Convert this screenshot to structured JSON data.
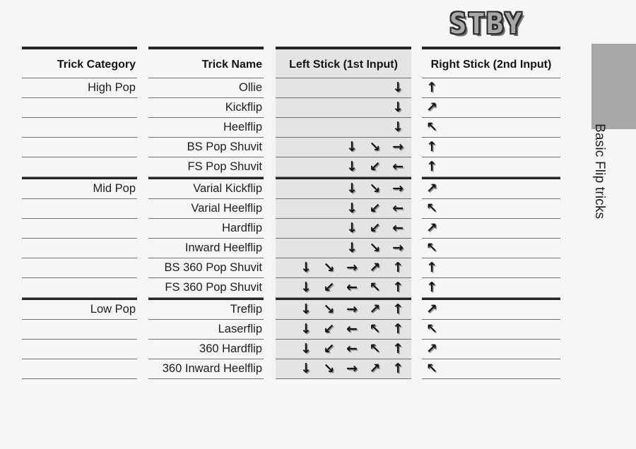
{
  "logo": {
    "text": "STBY"
  },
  "side_tab": {
    "label": "Basic Flip tricks",
    "block_color": "#a6a7a9"
  },
  "table": {
    "columns": [
      {
        "key": "category",
        "header": "Trick Category"
      },
      {
        "key": "name",
        "header": "Trick Name"
      },
      {
        "key": "left",
        "header": "Left Stick (1st Input)"
      },
      {
        "key": "right",
        "header": "Right Stick (2nd Input)"
      }
    ],
    "sections": [
      {
        "category": "High Pop",
        "rows": [
          {
            "name": "Ollie",
            "left": "↓",
            "right": "↑"
          },
          {
            "name": "Kickflip",
            "left": "↓",
            "right": "↗"
          },
          {
            "name": "Heelflip",
            "left": "↓",
            "right": "↖"
          },
          {
            "name": "BS Pop Shuvit",
            "left": "↓ ↘ →",
            "right": "↑"
          },
          {
            "name": "FS Pop Shuvit",
            "left": "↓ ↙ ←",
            "right": "↑"
          }
        ]
      },
      {
        "category": "Mid Pop",
        "rows": [
          {
            "name": "Varial Kickflip",
            "left": "↓ ↘ →",
            "right": "↗"
          },
          {
            "name": "Varial Heelflip",
            "left": "↓ ↙ ←",
            "right": "↖"
          },
          {
            "name": "Hardflip",
            "left": "↓ ↙ ←",
            "right": "↗"
          },
          {
            "name": "Inward Heelflip",
            "left": "↓ ↘ →",
            "right": "↖"
          },
          {
            "name": "BS 360 Pop Shuvit",
            "left": "↓ ↘ → ↗ ↑",
            "right": "↑"
          },
          {
            "name": "FS 360 Pop Shuvit",
            "left": "↓ ↙ ← ↖ ↑",
            "right": "↑"
          }
        ]
      },
      {
        "category": "Low Pop",
        "rows": [
          {
            "name": "Treflip",
            "left": "↓ ↘ → ↗ ↑",
            "right": "↗"
          },
          {
            "name": "Laserflip",
            "left": "↓ ↙ ← ↖ ↑",
            "right": "↖"
          },
          {
            "name": "360 Hardflip",
            "left": "↓ ↙ ← ↖ ↑",
            "right": "↗"
          },
          {
            "name": "360 Inward Heelflip",
            "left": "↓ ↘ → ↗ ↑",
            "right": "↖"
          }
        ]
      }
    ]
  }
}
